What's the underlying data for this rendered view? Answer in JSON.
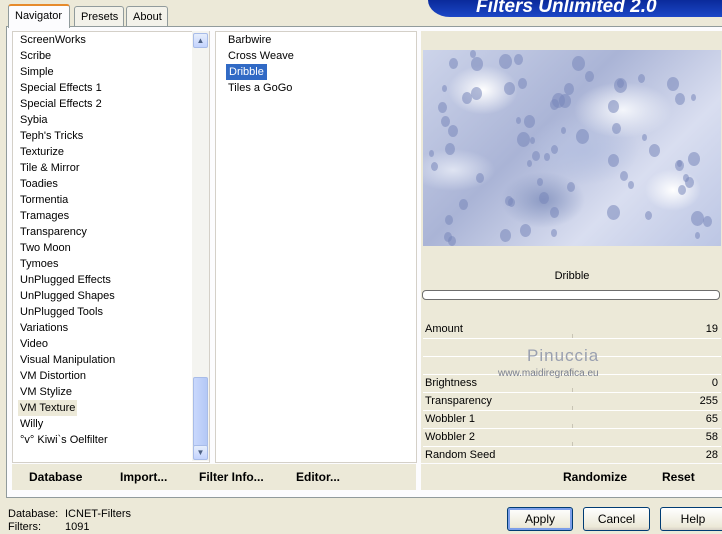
{
  "tabs": [
    "Navigator",
    "Presets",
    "About"
  ],
  "banner": "Filters Unlimited 2.0",
  "categories": [
    "ScreenWorks",
    "Scribe",
    "Simple",
    "Special Effects 1",
    "Special Effects 2",
    "Sybia",
    "Teph's Tricks",
    "Texturize",
    "Tile & Mirror",
    "Toadies",
    "Tormentia",
    "Tramages",
    "Transparency",
    "Two Moon",
    "Tymoes",
    "UnPlugged Effects",
    "UnPlugged Shapes",
    "UnPlugged Tools",
    "Variations",
    "Video",
    "Visual Manipulation",
    "VM Distortion",
    "VM Stylize",
    "VM Texture",
    "Willy",
    "°v° Kiwi`s Oelfilter"
  ],
  "selected_category": "VM Texture",
  "filters": [
    "Barbwire",
    "Cross Weave",
    "Dribble",
    "Tiles a GoGo"
  ],
  "selected_filter": "Dribble",
  "filter_title": "Dribble",
  "watermark": {
    "name": "Pinuccia",
    "url": "www.maidiregrafica.eu"
  },
  "params": [
    {
      "label": "Amount",
      "value": "19"
    },
    {
      "label": "Brightness",
      "value": "0"
    },
    {
      "label": "Transparency",
      "value": "255"
    },
    {
      "label": "Wobbler 1",
      "value": "65"
    },
    {
      "label": "Wobbler 2",
      "value": "58"
    },
    {
      "label": "Random Seed",
      "value": "28"
    }
  ],
  "toolbar": {
    "database": "Database",
    "import": "Import...",
    "filter_info": "Filter Info...",
    "editor": "Editor...",
    "randomize": "Randomize",
    "reset": "Reset"
  },
  "status": {
    "database_label": "Database:",
    "database_value": "ICNET-Filters",
    "filters_label": "Filters:",
    "filters_value": "1091"
  },
  "buttons": {
    "apply": "Apply",
    "cancel": "Cancel",
    "help": "Help"
  },
  "colors": {
    "selection": "#316ac5",
    "banner": "#0a2a9b",
    "tab_accent": "#e68b2c"
  }
}
